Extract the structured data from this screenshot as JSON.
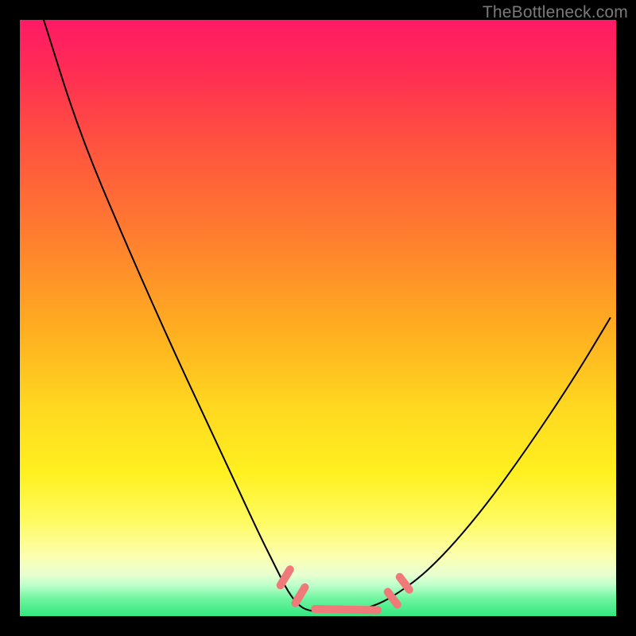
{
  "watermark": "TheBottleneck.com",
  "chart_data": {
    "type": "line",
    "title": "",
    "xlabel": "",
    "ylabel": "",
    "xlim": [
      0,
      100
    ],
    "ylim": [
      0,
      100
    ],
    "note": "Curve is a stylized bottleneck gauge; no labeled axes or numeric ticks are present. x/y are nominal 0-100 plot coordinates estimated from pixel positions.",
    "series": [
      {
        "name": "bottleneck-curve",
        "x": [
          4,
          10,
          18,
          26,
          34,
          40,
          43,
          45,
          47,
          49,
          51,
          55,
          59,
          63,
          69,
          77,
          85,
          93,
          99
        ],
        "y": [
          100,
          81,
          62,
          44,
          27,
          14,
          8,
          4,
          1.5,
          0.8,
          0.8,
          0.8,
          1.5,
          3.5,
          8,
          17,
          28,
          40,
          50
        ]
      }
    ],
    "markers": {
      "note": "salmon rounded markers near the curve minimum",
      "points": [
        {
          "x": 44.5,
          "y": 6.5
        },
        {
          "x": 47.0,
          "y": 3.5
        },
        {
          "x": 49.5,
          "y": 1.2
        },
        {
          "x": 53.0,
          "y": 0.9
        },
        {
          "x": 56.5,
          "y": 0.9
        },
        {
          "x": 60.0,
          "y": 1.0
        },
        {
          "x": 62.5,
          "y": 3.0
        },
        {
          "x": 64.5,
          "y": 5.5
        }
      ]
    },
    "gradient": {
      "note": "vertical gauge gradient from high (red, top) to low (green, bottom)",
      "stops": [
        {
          "pos": 0.0,
          "color": "#ff1a66"
        },
        {
          "pos": 0.2,
          "color": "#ff5040"
        },
        {
          "pos": 0.5,
          "color": "#ffae20"
        },
        {
          "pos": 0.76,
          "color": "#fff020"
        },
        {
          "pos": 0.93,
          "color": "#e8ffd0"
        },
        {
          "pos": 1.0,
          "color": "#32e77e"
        }
      ]
    }
  }
}
